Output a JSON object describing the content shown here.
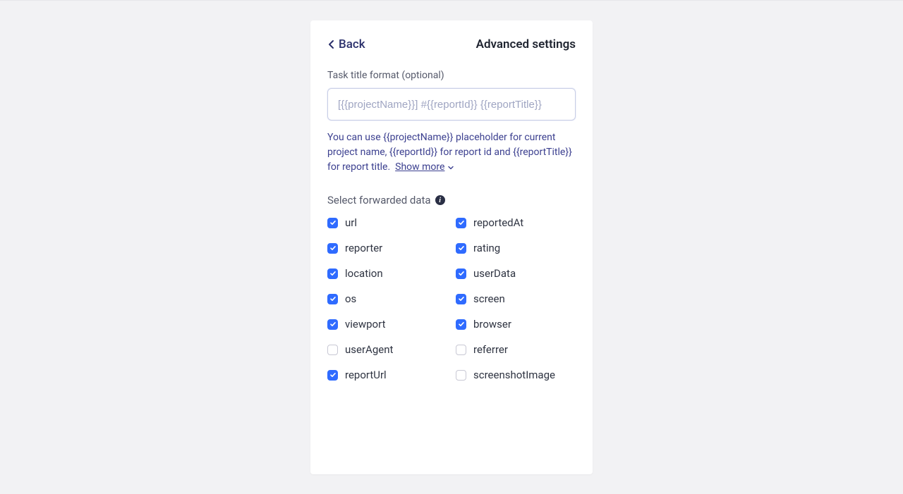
{
  "header": {
    "back_label": "Back",
    "title": "Advanced settings"
  },
  "task_title": {
    "label": "Task title format (optional)",
    "placeholder": "[{{projectName}}] #{{reportId}} {{reportTitle}}",
    "value": ""
  },
  "helper": {
    "text": "You can use {{projectName}} placeholder for current project name, {{reportId}} for report id and {{reportTitle}} for report title.",
    "show_more": "Show more"
  },
  "forward": {
    "label": "Select forwarded data",
    "items": [
      {
        "key": "url",
        "label": "url",
        "checked": true
      },
      {
        "key": "reportedAt",
        "label": "reportedAt",
        "checked": true
      },
      {
        "key": "reporter",
        "label": "reporter",
        "checked": true
      },
      {
        "key": "rating",
        "label": "rating",
        "checked": true
      },
      {
        "key": "location",
        "label": "location",
        "checked": true
      },
      {
        "key": "userData",
        "label": "userData",
        "checked": true
      },
      {
        "key": "os",
        "label": "os",
        "checked": true
      },
      {
        "key": "screen",
        "label": "screen",
        "checked": true
      },
      {
        "key": "viewport",
        "label": "viewport",
        "checked": true
      },
      {
        "key": "browser",
        "label": "browser",
        "checked": true
      },
      {
        "key": "userAgent",
        "label": "userAgent",
        "checked": false
      },
      {
        "key": "referrer",
        "label": "referrer",
        "checked": false
      },
      {
        "key": "reportUrl",
        "label": "reportUrl",
        "checked": true
      },
      {
        "key": "screenshotImage",
        "label": "screenshotImage",
        "checked": false
      }
    ]
  }
}
